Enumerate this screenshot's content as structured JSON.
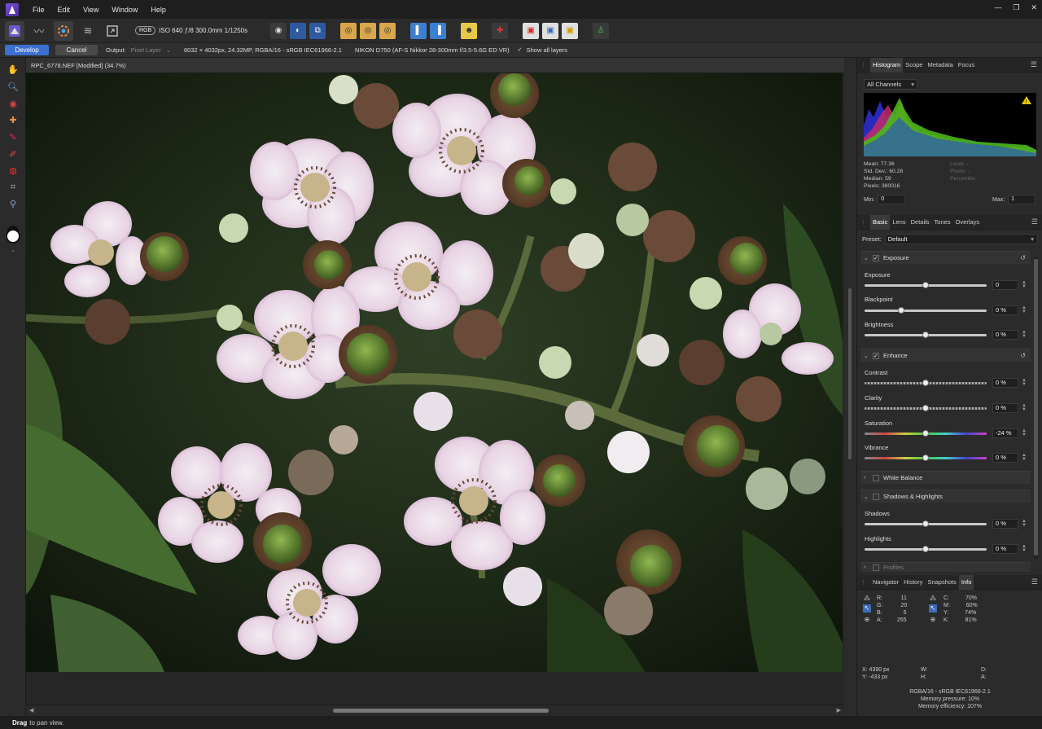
{
  "menubar": {
    "items": [
      "File",
      "Edit",
      "View",
      "Window",
      "Help"
    ],
    "window_controls": [
      "—",
      "❐",
      "✕"
    ]
  },
  "toolbar": {
    "color_mode": "RGB",
    "exif": "ISO 640 ƒ/8 300.0mm 1/1250s"
  },
  "context": {
    "develop_label": "Develop",
    "cancel_label": "Cancel",
    "output_label": "Output:",
    "output_value": "Pixel Layer",
    "image_info": "6032 × 4032px, 24.32MP, RGBA/16 - sRGB IEC61966-2.1",
    "camera_info": "NIKON D750 (AF-S Nikkor 28-300mm f/3.5-5.6G ED VR)",
    "show_layers_label": "Show all layers"
  },
  "document": {
    "title": "RPC_6778.NEF [Modified] (34.7%)"
  },
  "histogram_panel": {
    "tabs": [
      "Histogram",
      "Scope",
      "Metadata",
      "Focus"
    ],
    "active_tab": "Histogram",
    "channel_select": "All Channels",
    "stats_left": [
      "Mean: 77.36",
      "Std. Dev.: 60.28",
      "Median: 59",
      "Pixels: 380016"
    ],
    "stats_right": [
      "Level: -",
      "Pixels: -",
      "Percentile: -"
    ],
    "min_label": "Min:",
    "min_value": "0",
    "max_label": "Max:",
    "max_value": "1"
  },
  "adjust_panel": {
    "tabs": [
      "Basic",
      "Lens",
      "Details",
      "Tones",
      "Overlays"
    ],
    "active_tab": "Basic",
    "preset_label": "Preset:",
    "preset_value": "Default",
    "sections": {
      "exposure": "Exposure",
      "enhance": "Enhance",
      "white_balance": "White Balance",
      "shadows_highlights": "Shadows & Highlights",
      "profiles": "Profiles"
    },
    "sliders": {
      "exposure": {
        "label": "Exposure",
        "value": "0",
        "position": 0.5
      },
      "blackpoint": {
        "label": "Blackpoint",
        "value": "0 %",
        "position": 0.3
      },
      "brightness": {
        "label": "Brightness",
        "value": "0 %",
        "position": 0.5
      },
      "contrast": {
        "label": "Contrast",
        "value": "0 %",
        "position": 0.5
      },
      "clarity": {
        "label": "Clarity",
        "value": "0 %",
        "position": 0.5
      },
      "saturation": {
        "label": "Saturation",
        "value": "-24 %",
        "position": 0.5
      },
      "vibrance": {
        "label": "Vibrance",
        "value": "0 %",
        "position": 0.5
      },
      "shadows": {
        "label": "Shadows",
        "value": "0 %",
        "position": 0.5
      },
      "highlights": {
        "label": "Highlights",
        "value": "0 %",
        "position": 0.5
      }
    }
  },
  "info_panel": {
    "tabs": [
      "Navigator",
      "History",
      "Snapshots",
      "Info"
    ],
    "active_tab": "Info",
    "rgb": [
      {
        "k": "R:",
        "v": "11"
      },
      {
        "k": "G:",
        "v": "20"
      },
      {
        "k": "B:",
        "v": "5"
      },
      {
        "k": "A:",
        "v": "255"
      }
    ],
    "cmyk": [
      {
        "k": "C:",
        "v": "70%"
      },
      {
        "k": "M:",
        "v": "60%"
      },
      {
        "k": "Y:",
        "v": "74%"
      },
      {
        "k": "K:",
        "v": "81%"
      }
    ],
    "x": "X: 4390 px",
    "y": "Y: -433 px",
    "w": "W:",
    "h": "H:",
    "d": "D:",
    "a": "A:",
    "footer": [
      "RGBA/16 - sRGB IEC61966-2.1",
      "Memory pressure: 10%",
      "Memory efficiency: 107%"
    ]
  },
  "status": {
    "action": "Drag",
    "hint": "to pan view."
  },
  "colors": {
    "accent": "#3b6fd0",
    "background": "#2b2b2b"
  }
}
